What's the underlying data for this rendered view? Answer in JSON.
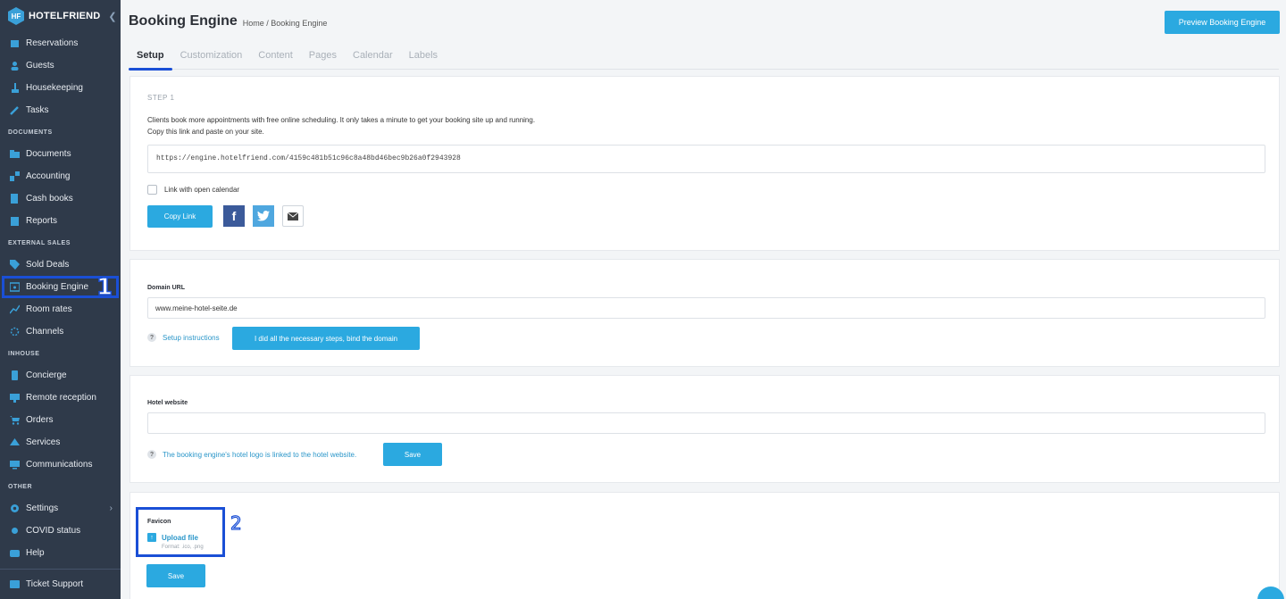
{
  "app": {
    "logo_text": "HOTELFRIEND",
    "logo_mark": "HF"
  },
  "sidebar": {
    "items_top": [
      {
        "label": "Reservations",
        "icon": "calendar-icon"
      },
      {
        "label": "Guests",
        "icon": "person-icon"
      },
      {
        "label": "Housekeeping",
        "icon": "broom-icon"
      },
      {
        "label": "Tasks",
        "icon": "wrench-icon"
      }
    ],
    "section_documents": "DOCUMENTS",
    "items_documents": [
      {
        "label": "Documents",
        "icon": "folder-icon"
      },
      {
        "label": "Accounting",
        "icon": "chart-icon"
      },
      {
        "label": "Cash books",
        "icon": "book-icon"
      },
      {
        "label": "Reports",
        "icon": "report-icon"
      }
    ],
    "section_external": "EXTERNAL SALES",
    "items_external": [
      {
        "label": "Sold Deals",
        "icon": "tag-icon"
      },
      {
        "label": "Booking Engine",
        "icon": "engine-icon"
      },
      {
        "label": "Room rates",
        "icon": "trend-icon"
      },
      {
        "label": "Channels",
        "icon": "network-icon"
      }
    ],
    "section_inhouse": "INHOUSE",
    "items_inhouse": [
      {
        "label": "Concierge",
        "icon": "phone-icon"
      },
      {
        "label": "Remote reception",
        "icon": "reception-icon"
      },
      {
        "label": "Orders",
        "icon": "cart-icon"
      },
      {
        "label": "Services",
        "icon": "services-icon"
      },
      {
        "label": "Communications",
        "icon": "monitor-icon"
      }
    ],
    "section_other": "OTHER",
    "items_other": [
      {
        "label": "Settings",
        "icon": "gear-icon"
      },
      {
        "label": "COVID status",
        "icon": "virus-icon"
      },
      {
        "label": "Help",
        "icon": "help-icon"
      }
    ],
    "ticket_support": "Ticket Support",
    "annotation_1": "1"
  },
  "header": {
    "title": "Booking Engine",
    "breadcrumb": "Home / Booking Engine",
    "preview_button": "Preview Booking Engine"
  },
  "tabs": [
    "Setup",
    "Customization",
    "Content",
    "Pages",
    "Calendar",
    "Labels"
  ],
  "step1": {
    "step_label": "STEP 1",
    "desc_line1": "Clients book more appointments with free online scheduling. It only takes a minute to get your booking site up and running.",
    "desc_line2": "Copy this link and paste on your site.",
    "link": "https://engine.hotelfriend.com/4159c481b51c96c8a48bd46bec9b26a0f2943928",
    "checkbox_label": "Link with open calendar",
    "copy_button": "Copy Link"
  },
  "domain": {
    "label": "Domain URL",
    "value": "www.meine-hotel-seite.de",
    "help_link": "Setup instructions",
    "bind_button": "I did all the necessary steps, bind the domain"
  },
  "website": {
    "label": "Hotel website",
    "value": "",
    "help_text": "The booking engine's hotel logo is linked to the hotel website.",
    "save_button": "Save"
  },
  "favicon": {
    "label": "Favicon",
    "upload_label": "Upload file",
    "format_hint": "Format: .ico, .png",
    "save_button": "Save",
    "annotation_2": "2"
  }
}
